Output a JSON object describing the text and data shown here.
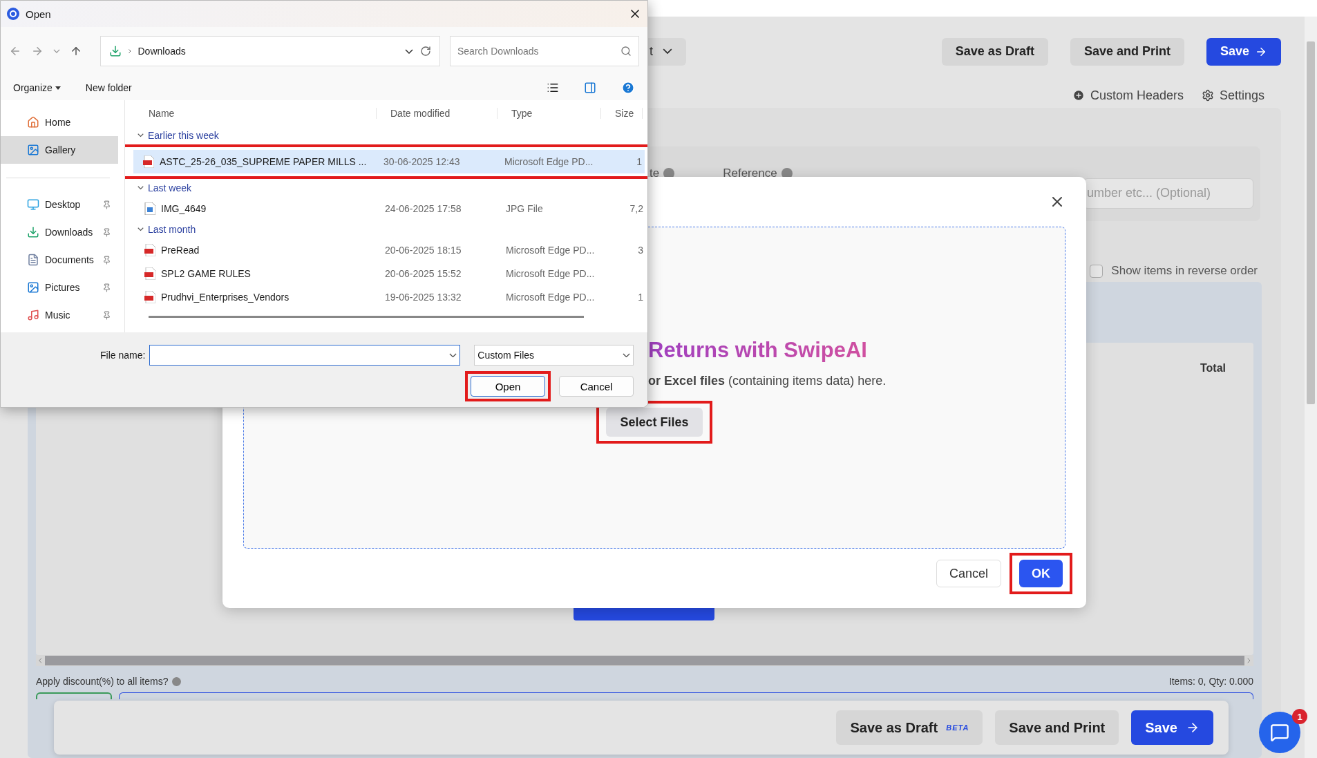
{
  "page": {
    "toolbar": {
      "dropdown": "t",
      "buttons": [
        {
          "label": "Save as Draft",
          "primary": false
        },
        {
          "label": "Save and Print",
          "primary": false
        },
        {
          "label": "Save",
          "primary": true
        }
      ]
    },
    "links": [
      "Custom Headers",
      "Settings"
    ],
    "fields": [
      "te",
      "Reference"
    ],
    "reference_placeholder": "umber etc... (Optional)",
    "reverse_order": {
      "label": "Show items in reverse order",
      "checked": false
    },
    "table": {
      "columns": [
        "Total"
      ]
    },
    "discount_label": "Apply discount(%) to all items?",
    "summary": "Items: 0, Qty: 0.000",
    "footer_buttons": [
      {
        "label": "Save as Draft",
        "badge": "BETA",
        "primary": false
      },
      {
        "label": "Save and Print",
        "primary": false
      },
      {
        "label": "Save",
        "primary": true
      }
    ],
    "chat_badge": "1"
  },
  "modal": {
    "title": "Returns with SwipeAI",
    "description": "**or Excel files** (containing items data) here.",
    "select_button": {
      "label": "Select Files",
      "highlighted": true
    },
    "buttons": [
      {
        "label": "Cancel",
        "primary": false,
        "highlighted": false
      },
      {
        "label": "OK",
        "primary": true,
        "highlighted": true
      }
    ]
  },
  "file_dialog": {
    "title": "Open",
    "location": "Downloads",
    "search_placeholder": "Search Downloads",
    "commands": [
      "Organize",
      "New folder"
    ],
    "sidebar": [
      {
        "items": [
          {
            "label": "Home",
            "selected": false,
            "pinned": false
          },
          {
            "label": "Gallery",
            "selected": true,
            "pinned": false
          }
        ]
      },
      {
        "items": [
          {
            "label": "Desktop",
            "selected": false,
            "pinned": true
          },
          {
            "label": "Downloads",
            "selected": false,
            "pinned": true
          },
          {
            "label": "Documents",
            "selected": false,
            "pinned": true
          },
          {
            "label": "Pictures",
            "selected": false,
            "pinned": true
          },
          {
            "label": "Music",
            "selected": false,
            "pinned": true
          }
        ]
      }
    ],
    "columns": [
      "Name",
      "Date modified",
      "Type",
      "Size"
    ],
    "groups": [
      {
        "label": "Earlier this week",
        "files": [
          {
            "name": "ASTC_25-26_035_SUPREME PAPER MILLS ...",
            "date": "30-06-2025 12:43",
            "type": "Microsoft Edge PD...",
            "size": "1",
            "kind": "pdf",
            "selected": true,
            "highlighted": true
          }
        ]
      },
      {
        "label": "Last week",
        "files": [
          {
            "name": "IMG_4649",
            "date": "24-06-2025 17:58",
            "type": "JPG File",
            "size": "7,2",
            "kind": "image",
            "selected": false,
            "highlighted": false
          }
        ]
      },
      {
        "label": "Last month",
        "files": [
          {
            "name": "PreRead",
            "date": "20-06-2025 18:15",
            "type": "Microsoft Edge PD...",
            "size": "3",
            "kind": "pdf",
            "selected": false,
            "highlighted": false
          },
          {
            "name": "SPL2 GAME RULES",
            "date": "20-06-2025 15:52",
            "type": "Microsoft Edge PD...",
            "kind": "pdf",
            "selected": false,
            "highlighted": false
          },
          {
            "name": "Prudhvi_Enterprises_Vendors",
            "date": "19-06-2025 13:32",
            "type": "Microsoft Edge PD...",
            "size": "1",
            "kind": "pdf",
            "selected": false,
            "highlighted": false
          }
        ]
      }
    ],
    "file_name_label": "File name:",
    "file_type": "Custom Files",
    "buttons": [
      {
        "label": "Open",
        "default": true,
        "highlighted": true
      },
      {
        "label": "Cancel",
        "default": false,
        "highlighted": false
      }
    ]
  }
}
